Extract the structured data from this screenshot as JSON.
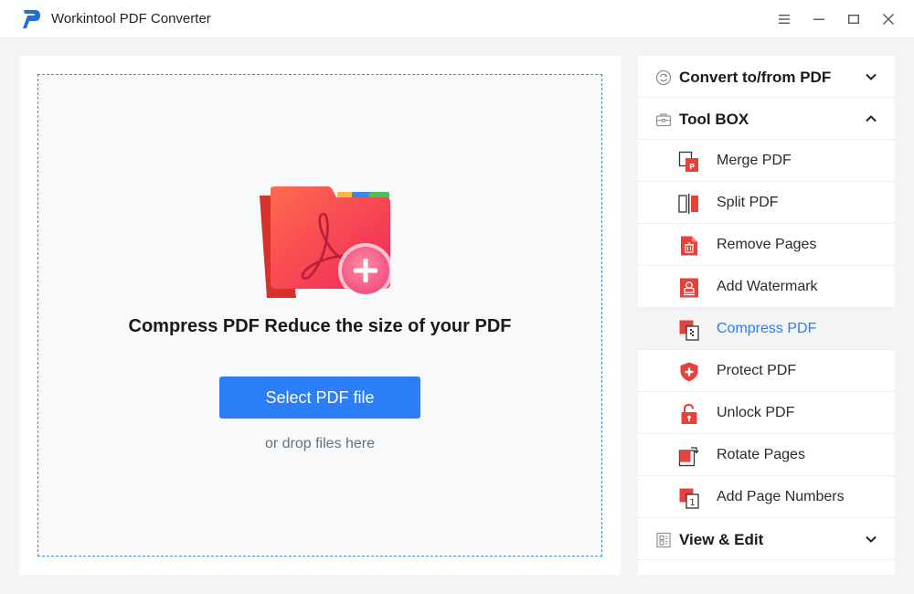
{
  "app": {
    "title": "Workintool PDF Converter"
  },
  "main": {
    "headline": "Compress PDF Reduce the size of your PDF",
    "select_button": "Select PDF file",
    "drop_hint": "or drop files here"
  },
  "sidebar": {
    "sections": [
      {
        "label": "Convert to/from PDF",
        "icon": "convert-icon",
        "expanded": false
      },
      {
        "label": "Tool BOX",
        "icon": "toolbox-icon",
        "expanded": true
      },
      {
        "label": "View & Edit",
        "icon": "view-edit-icon",
        "expanded": false
      }
    ],
    "items": [
      {
        "label": "Merge PDF",
        "icon": "merge-pdf-icon"
      },
      {
        "label": "Split PDF",
        "icon": "split-pdf-icon"
      },
      {
        "label": "Remove Pages",
        "icon": "remove-pages-icon"
      },
      {
        "label": "Add Watermark",
        "icon": "add-watermark-icon"
      },
      {
        "label": "Compress PDF",
        "icon": "compress-pdf-icon",
        "active": true
      },
      {
        "label": "Protect PDF",
        "icon": "protect-pdf-icon"
      },
      {
        "label": "Unlock PDF",
        "icon": "unlock-pdf-icon"
      },
      {
        "label": "Rotate Pages",
        "icon": "rotate-pages-icon"
      },
      {
        "label": "Add Page Numbers",
        "icon": "add-page-numbers-icon"
      }
    ]
  },
  "colors": {
    "accent": "#2b7ef6",
    "icon_red": "#e8413c",
    "dropzone_border": "#4a90c8"
  }
}
